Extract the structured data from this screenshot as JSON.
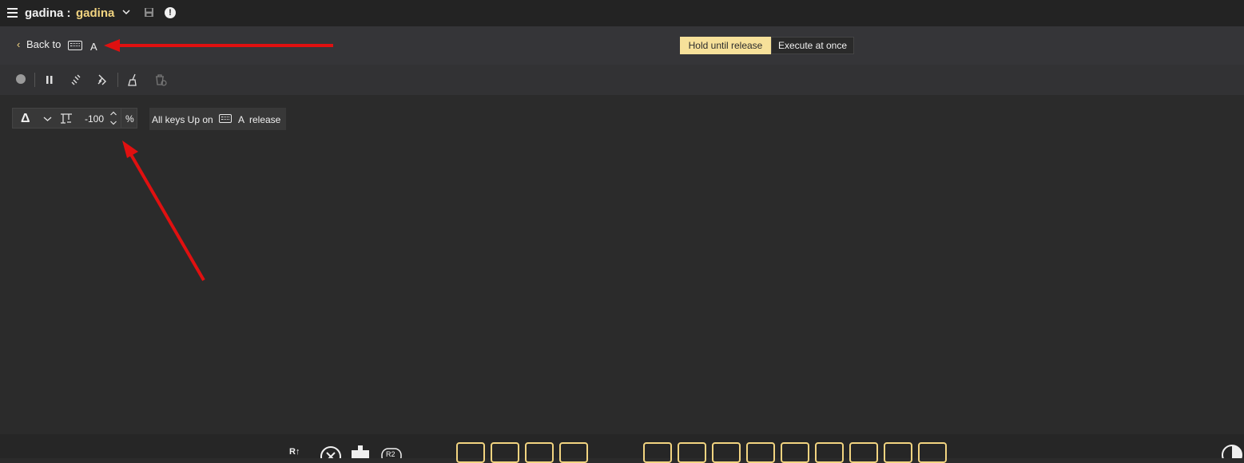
{
  "topbar": {
    "app_name": "gadina :",
    "profile_name": "gadina"
  },
  "header": {
    "back_label": "Back to",
    "back_key": "A",
    "mode_hold": "Hold until release",
    "mode_execute": "Execute at once"
  },
  "step": {
    "amount": "-100",
    "unit": "%"
  },
  "release": {
    "label_before": "All keys Up on",
    "key": "A",
    "label_after": "release"
  },
  "colors": {
    "accent": "#f2d480",
    "active_mode_bg": "#f7e19a",
    "annotation": "#e01010"
  },
  "icons": {
    "toolbar": [
      "record-icon",
      "pause-icon",
      "unlink-icon",
      "link-icon",
      "brush-icon",
      "trash-icon"
    ],
    "bottom": [
      "r-up-icon",
      "close-circle-icon",
      "dpad-icon",
      "r2-icon",
      "prev-icon",
      "stop-icon",
      "play-icon",
      "next-icon",
      "vol-down-icon",
      "vol-icon",
      "vol-up-icon",
      "globe-icon",
      "no-globe-icon",
      "star-icon",
      "refresh-icon",
      "pen-icon",
      "lambda-icon",
      "contrast-icon"
    ]
  }
}
